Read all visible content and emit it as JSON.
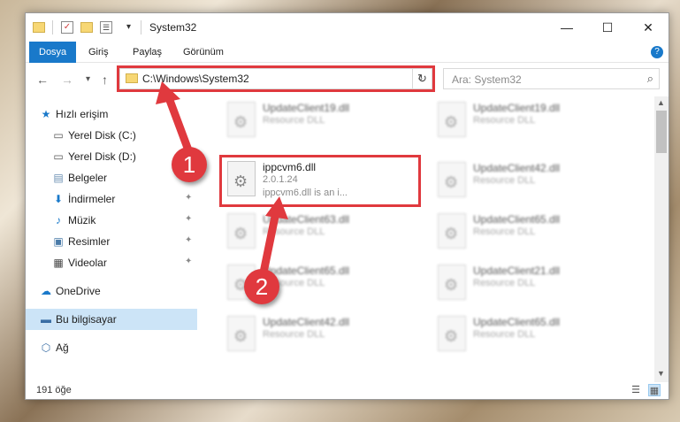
{
  "window": {
    "title": "System32",
    "controls": {
      "minimize": "—",
      "maximize": "☐",
      "close": "✕"
    }
  },
  "ribbon": {
    "tabs": [
      {
        "label": "Dosya",
        "active": true
      },
      {
        "label": "Giriş"
      },
      {
        "label": "Paylaş"
      },
      {
        "label": "Görünüm"
      }
    ],
    "help": "?"
  },
  "nav": {
    "back": "←",
    "forward": "→",
    "recent": "▾",
    "up": "↑",
    "address": "C:\\Windows\\System32",
    "address_dropdown": "⌄",
    "refresh": "↻",
    "search_placeholder": "Ara: System32"
  },
  "sidebar": {
    "items": [
      {
        "label": "Hızlı erişim",
        "icon": "star-icon",
        "glyph": "★",
        "color": "#1979ca"
      },
      {
        "label": "Yerel Disk (C:)",
        "icon": "drive-icon",
        "glyph": "▭",
        "color": "#555555"
      },
      {
        "label": "Yerel Disk (D:)",
        "icon": "drive-icon",
        "glyph": "▭",
        "color": "#555555"
      },
      {
        "label": "Belgeler",
        "icon": "documents-icon",
        "glyph": "▤",
        "color": "#6b8fb3",
        "pinned": true
      },
      {
        "label": "İndirmeler",
        "icon": "download-icon",
        "glyph": "⬇",
        "color": "#1979ca",
        "pinned": true
      },
      {
        "label": "Müzik",
        "icon": "music-icon",
        "glyph": "♪",
        "color": "#1979ca",
        "pinned": true
      },
      {
        "label": "Resimler",
        "icon": "pictures-icon",
        "glyph": "▣",
        "color": "#4a7ba8",
        "pinned": true
      },
      {
        "label": "Videolar",
        "icon": "videos-icon",
        "glyph": "▦",
        "color": "#444444",
        "pinned": true
      },
      {
        "label": "OneDrive",
        "icon": "cloud-icon",
        "glyph": "☁",
        "color": "#1979ca"
      },
      {
        "label": "Bu bilgisayar",
        "icon": "computer-icon",
        "glyph": "▬",
        "color": "#3a6ea5",
        "selected": true
      },
      {
        "label": "Ağ",
        "icon": "network-icon",
        "glyph": "⬡",
        "color": "#3a6ea5"
      }
    ],
    "pin_glyph": "📌"
  },
  "files": {
    "left_column": [
      {
        "name": "UpdateClient19.dll",
        "type": "Resource DLL"
      },
      {
        "name": "ippcvm6.dll",
        "version": "2.0.1.24",
        "description": "ippcvm6.dll is an i...",
        "highlighted": true
      },
      {
        "name": "UpdateClient63.dll",
        "type": "Resource DLL"
      },
      {
        "name": "UpdateClient65.dll",
        "type": "Resource DLL"
      },
      {
        "name": "UpdateClient42.dll",
        "type": "Resource DLL"
      }
    ],
    "right_column": [
      {
        "name": "UpdateClient19.dll",
        "type": "Resource DLL"
      },
      {
        "name": "UpdateClient42.dll",
        "type": "Resource DLL"
      },
      {
        "name": "UpdateClient65.dll",
        "type": "Resource DLL"
      },
      {
        "name": "UpdateClient21.dll",
        "type": "Resource DLL"
      },
      {
        "name": "UpdateClient65.dll",
        "type": "Resource DLL"
      }
    ]
  },
  "status": {
    "count": "191 öğe"
  },
  "annotations": {
    "callout_1": "1",
    "callout_2": "2",
    "color": "#e0393e"
  }
}
